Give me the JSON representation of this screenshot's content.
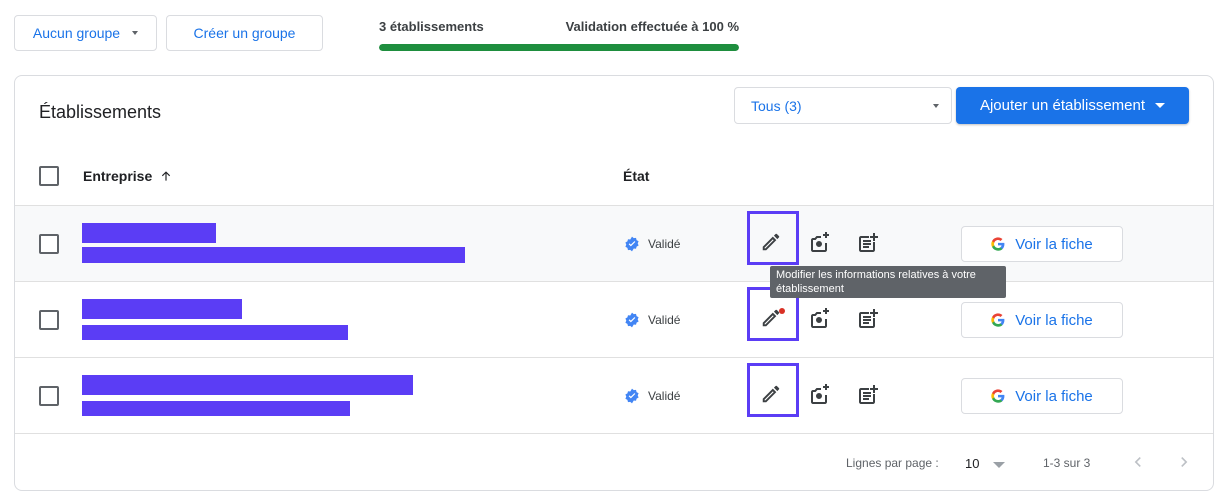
{
  "toolbar": {
    "group_select_label": "Aucun groupe",
    "create_group_label": "Créer un groupe"
  },
  "progress": {
    "count_label": "3 établissements",
    "validation_label": "Validation effectuée à 100 %",
    "percent": 100
  },
  "card": {
    "title": "Établissements",
    "filter_label": "Tous (3)",
    "add_button_label": "Ajouter un établissement"
  },
  "table": {
    "headers": {
      "enterprise": "Entreprise",
      "state": "État"
    },
    "rows": [
      {
        "status": "Validé",
        "action_label": "Voir la fiche"
      },
      {
        "status": "Validé",
        "action_label": "Voir la fiche"
      },
      {
        "status": "Validé",
        "action_label": "Voir la fiche"
      }
    ]
  },
  "tooltip": {
    "text": "Modifier les informations relatives à votre établissement"
  },
  "footer": {
    "rows_per_page_label": "Lignes par page :",
    "rows_per_page_value": "10",
    "range_label": "1-3 sur 3"
  },
  "colors": {
    "primary": "#1a73e8",
    "success": "#1e8e3e",
    "highlight_box": "#5b3df5",
    "redaction": "#5b3df5",
    "notification_dot": "#d93025"
  },
  "icons": [
    "caret-down-icon",
    "arrow-up-icon",
    "verified-icon",
    "edit-icon",
    "add-photo-icon",
    "add-post-icon",
    "google-g-icon",
    "chevron-left-icon",
    "chevron-right-icon"
  ]
}
